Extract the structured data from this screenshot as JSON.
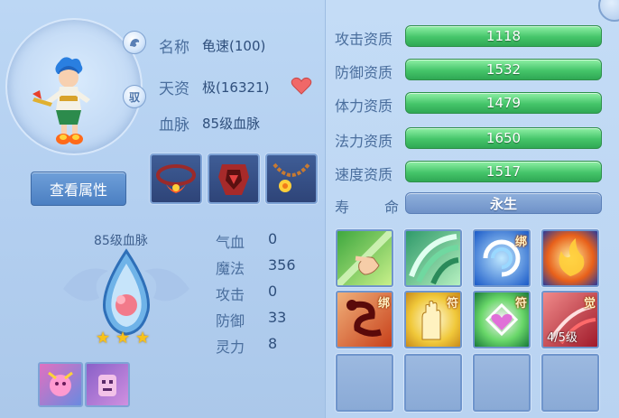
{
  "pet": {
    "name_label": "名称",
    "name_value": "龟速(100)",
    "talent_label": "天资",
    "talent_value": "极(16321)",
    "bloodline_label": "血脉",
    "bloodline_value": "85级血脉"
  },
  "icons": {
    "dragon_icon": "dragon-icon",
    "drive_icon_text": "驭"
  },
  "view_attributes_button": "查看属性",
  "bloodline_panel": {
    "title": "85级血脉",
    "stars": 3,
    "stats": [
      {
        "label": "气血",
        "value": "0"
      },
      {
        "label": "魔法",
        "value": "356"
      },
      {
        "label": "攻击",
        "value": "0"
      },
      {
        "label": "防御",
        "value": "33"
      },
      {
        "label": "灵力",
        "value": "8"
      }
    ]
  },
  "aptitudes": [
    {
      "label": "攻击资质",
      "value": "1118"
    },
    {
      "label": "防御资质",
      "value": "1532"
    },
    {
      "label": "体力资质",
      "value": "1479"
    },
    {
      "label": "法力资质",
      "value": "1650"
    },
    {
      "label": "速度资质",
      "value": "1517"
    }
  ],
  "lifespan": {
    "label_a": "寿",
    "label_b": "命",
    "value": "永生"
  },
  "skills": [
    {
      "icon": "finger-strike-skill-icon",
      "tag": ""
    },
    {
      "icon": "green-wind-skill-icon",
      "tag": ""
    },
    {
      "icon": "water-vortex-skill-icon",
      "tag": "绑"
    },
    {
      "icon": "fire-burst-skill-icon",
      "tag": ""
    },
    {
      "icon": "red-serpent-skill-icon",
      "tag": "绑"
    },
    {
      "icon": "golden-palm-skill-icon",
      "tag": "符"
    },
    {
      "icon": "heart-gem-skill-icon",
      "tag": "符"
    },
    {
      "icon": "red-flame-skill-icon",
      "tag": "觉",
      "level": "4/5级"
    }
  ],
  "colors": {
    "bar_green": "#45c56a",
    "bar_blue": "#6f92c8",
    "panel_bg": "#bcd7f4"
  }
}
